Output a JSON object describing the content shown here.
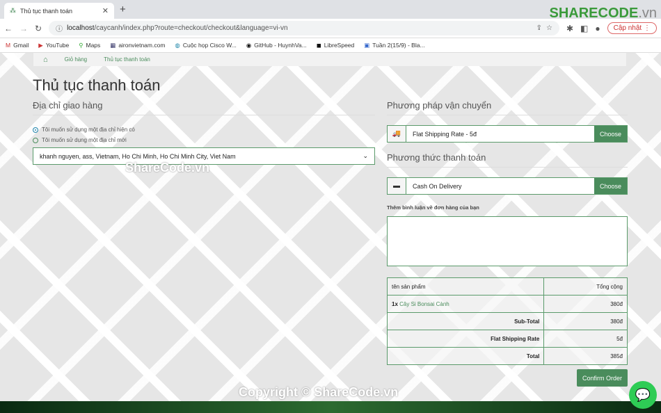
{
  "browser": {
    "tab_title": "Thủ tục thanh toán",
    "url_host": "localhost",
    "url_path": "/caycanh/index.php?route=checkout/checkout&language=vi-vn",
    "update_label": "Cập nhật",
    "bookmarks": [
      "Gmail",
      "YouTube",
      "Maps",
      "aironvietnam.com",
      "Cuộc họp Cisco W...",
      "GitHub - HuynhVa...",
      "LibreSpeed",
      "Tuần 2(15/9) - Bla..."
    ]
  },
  "logo": {
    "brand": "SHARECODE",
    "suffix": ".vn"
  },
  "breadcrumb": [
    "Giỏ hàng",
    "Thủ tục thanh toán"
  ],
  "page": {
    "title": "Thủ tục thanh toán"
  },
  "shipping_address": {
    "heading": "Địa chỉ giao hàng",
    "option_existing": "Tôi muốn sử dụng một địa chỉ hiện có",
    "option_new": "Tôi muốn sử dụng một địa chỉ mới",
    "selected": "khanh nguyen, ass, Vietnam, Ho Chi Minh, Ho Chi Minh City, Viet Nam"
  },
  "shipping_method": {
    "heading": "Phương pháp vận chuyển",
    "value": "Flat Shipping Rate - 5đ",
    "button": "Choose"
  },
  "payment_method": {
    "heading": "Phương thức thanh toán",
    "value": "Cash On Delivery",
    "button": "Choose"
  },
  "comment": {
    "label": "Thêm bình luận về đơn hàng của bạn"
  },
  "order": {
    "col_product": "tên sản phẩm",
    "col_total": "Tổng cộng",
    "item_qty": "1x",
    "item_name": "Cây Si Bonsai Cành",
    "item_total": "380đ",
    "rows": [
      {
        "label": "Sub-Total",
        "value": "380đ"
      },
      {
        "label": "Flat Shipping Rate",
        "value": "5đ"
      },
      {
        "label": "Total",
        "value": "385đ"
      }
    ]
  },
  "confirm_label": "Confirm Order",
  "watermarks": {
    "mid": "ShareCode.vn",
    "bottom": "Copyright © ShareCode.vn"
  },
  "colors": {
    "accent": "#4a8c5c"
  }
}
